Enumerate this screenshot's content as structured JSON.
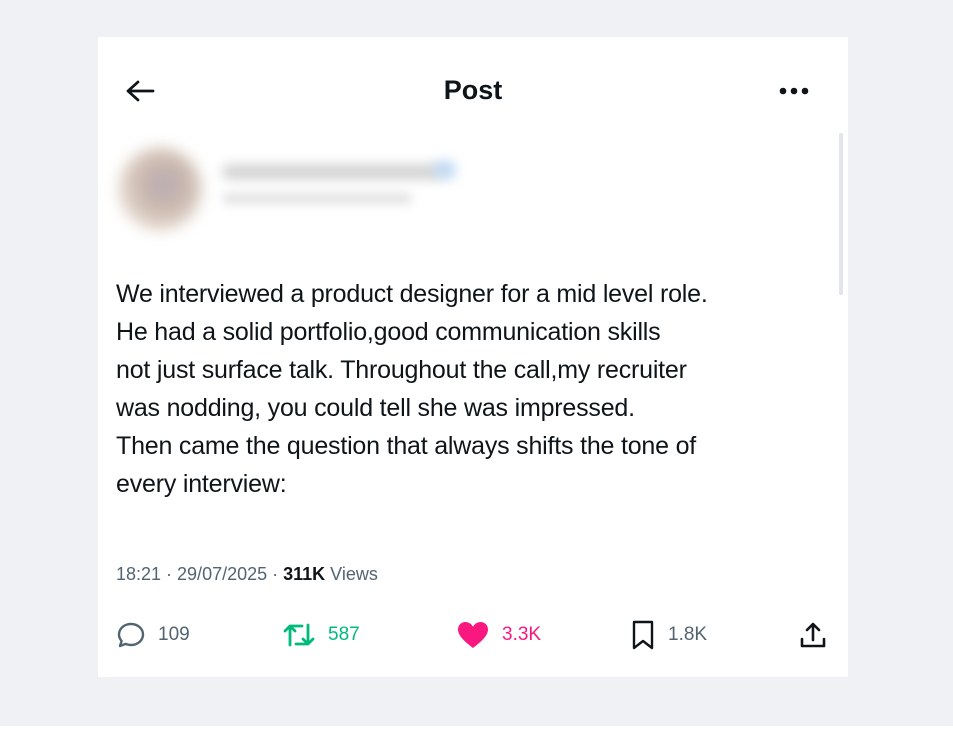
{
  "header": {
    "title": "Post"
  },
  "post": {
    "text": "We interviewed a product designer for a mid level role.\nHe had a solid portfolio,good communication skills\nnot just surface talk. Throughout the call,my recruiter\nwas nodding, you could tell she was impressed.\nThen came the question that always shifts the tone of\nevery interview:",
    "timestamp": "18:21 · 29/07/2025 · ",
    "views_count": "311K",
    "views_label": " Views"
  },
  "actions": {
    "replies": "109",
    "reposts": "587",
    "likes": "3.3K",
    "bookmarks": "1.8K"
  },
  "icons": {
    "back": "arrow-left-icon",
    "more": "more-horizontal-icon",
    "reply": "reply-bubble-icon",
    "repost": "repost-icon",
    "like": "heart-icon",
    "bookmark": "bookmark-icon",
    "share": "share-icon"
  },
  "colors": {
    "text": "#0f1419",
    "secondary": "#536471",
    "repost": "#00ba7c",
    "like": "#f91880",
    "backdrop": "#eff1f5"
  }
}
